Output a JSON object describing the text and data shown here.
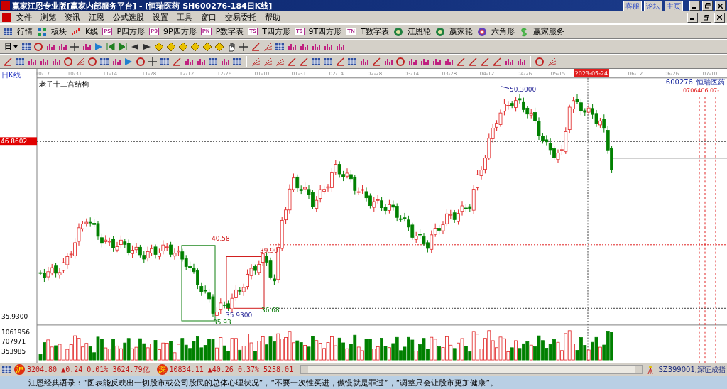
{
  "window": {
    "title": "赢家江恩专业版[赢家内部服务平台] - [恒瑞医药   SH600276-184日K线]",
    "links": [
      "客服",
      "论坛",
      "主页"
    ]
  },
  "menu": [
    "文件",
    "浏览",
    "资讯",
    "江恩",
    "公式选股",
    "设置",
    "工具",
    "窗口",
    "交易委托",
    "帮助"
  ],
  "toolbar": [
    {
      "label": "行情",
      "kind": "grid"
    },
    {
      "label": "板块",
      "kind": "blocks"
    },
    {
      "label": "K线",
      "kind": "kline"
    },
    {
      "label": "P四方形",
      "kind": "badge",
      "badge": "PS"
    },
    {
      "label": "9P四方形",
      "kind": "badge",
      "badge": "P9"
    },
    {
      "label": "P数字表",
      "kind": "badge",
      "badge": "PN"
    },
    {
      "label": "T四方形",
      "kind": "badge",
      "badge": "TS"
    },
    {
      "label": "9T四方形",
      "kind": "badge",
      "badge": "T9"
    },
    {
      "label": "T数字表",
      "kind": "badge",
      "badge": "TN"
    },
    {
      "label": "江恩轮",
      "kind": "wheel"
    },
    {
      "label": "赢家轮",
      "kind": "wheel"
    },
    {
      "label": "六角形",
      "kind": "hex"
    },
    {
      "label": "赢家服务",
      "kind": "dollar"
    }
  ],
  "period": "日",
  "chart": {
    "title": "日K线",
    "study": "老子十二宫结构",
    "dates": [
      {
        "label": "10-17",
        "selected": false
      },
      {
        "label": "10-31",
        "selected": false
      },
      {
        "label": "11-14",
        "selected": false
      },
      {
        "label": "11-28",
        "selected": false
      },
      {
        "label": "12-12",
        "selected": false
      },
      {
        "label": "12-26",
        "selected": false
      },
      {
        "label": "01-10",
        "selected": false
      },
      {
        "label": "01-31",
        "selected": false
      },
      {
        "label": "02-14",
        "selected": false
      },
      {
        "label": "02-28",
        "selected": false
      },
      {
        "label": "03-14",
        "selected": false
      },
      {
        "label": "03-28",
        "selected": false
      },
      {
        "label": "04-12",
        "selected": false
      },
      {
        "label": "04-26",
        "selected": false
      },
      {
        "label": "05-15",
        "selected": false
      },
      {
        "label": "2023-05-24",
        "selected": true
      },
      {
        "label": "06-12",
        "selected": false
      },
      {
        "label": "06-26",
        "selected": false
      },
      {
        "label": "07-10",
        "selected": false
      }
    ],
    "symbol": "600276",
    "name": "恒瑞医药",
    "future_dates": "0706406 07-",
    "price_labels": [
      {
        "text": "46.8602",
        "kind": "current"
      },
      {
        "text": "35.9300",
        "kind": "low"
      }
    ],
    "volume_labels": [
      "1061956",
      "707971",
      "353985"
    ],
    "annotations": [
      {
        "text": "50.3000",
        "kind": "extreme"
      },
      {
        "text": "40.58",
        "kind": "resistance"
      },
      {
        "text": "39.90",
        "kind": "resistance"
      },
      {
        "text": "36.68",
        "kind": "support"
      },
      {
        "text": "35.93",
        "kind": "support"
      },
      {
        "text": "35.9300",
        "kind": "extreme"
      }
    ]
  },
  "status": {
    "indices": [
      {
        "badge": "沪",
        "text": "3204.80 ▲0.24 0.01% 3624.79亿"
      },
      {
        "badge": "深",
        "text": "10834.11 ▲40.26 0.37% 5258.01"
      }
    ],
    "symbol": "SZ399001,深证成指"
  },
  "quote": "江恩经典语录：“图表能反映出一切股市或公司股民的总体心理状况”，“不要一次性买进，傲慢就是罪过”，“调整只会让股市更加健康”。"
}
